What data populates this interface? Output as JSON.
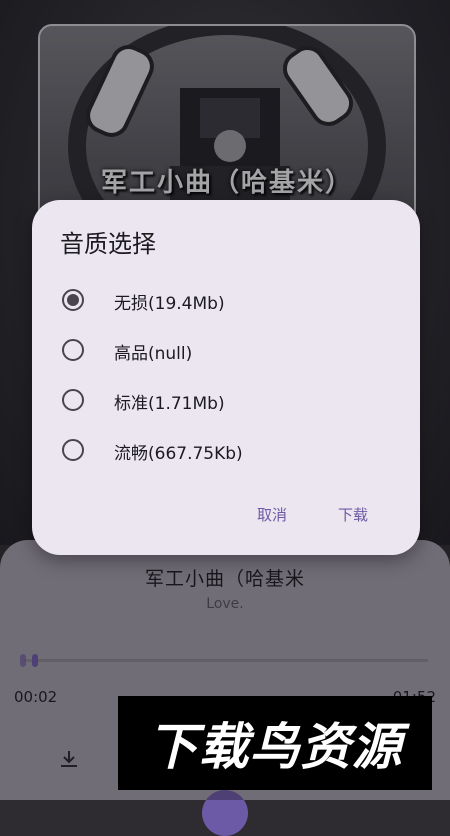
{
  "cover": {
    "title_text": "军工小曲（哈基米）"
  },
  "player": {
    "song_title": "军工小曲（哈基米",
    "artist": "Love.",
    "time_current": "00:02",
    "time_total": "01:52",
    "progress": 0.02
  },
  "dialog": {
    "title": "音质选择",
    "options": [
      {
        "label": "无损(19.4Mb)",
        "selected": true
      },
      {
        "label": "高品(null)",
        "selected": false
      },
      {
        "label": "标准(1.71Mb)",
        "selected": false
      },
      {
        "label": "流畅(667.75Kb)",
        "selected": false
      }
    ],
    "cancel_label": "取消",
    "confirm_label": "下载"
  },
  "watermark": {
    "text": "下载鸟资源"
  },
  "colors": {
    "accent": "#6d5aa6",
    "dialog_bg": "#ece6f0",
    "player_bg": "#a49fa9"
  }
}
